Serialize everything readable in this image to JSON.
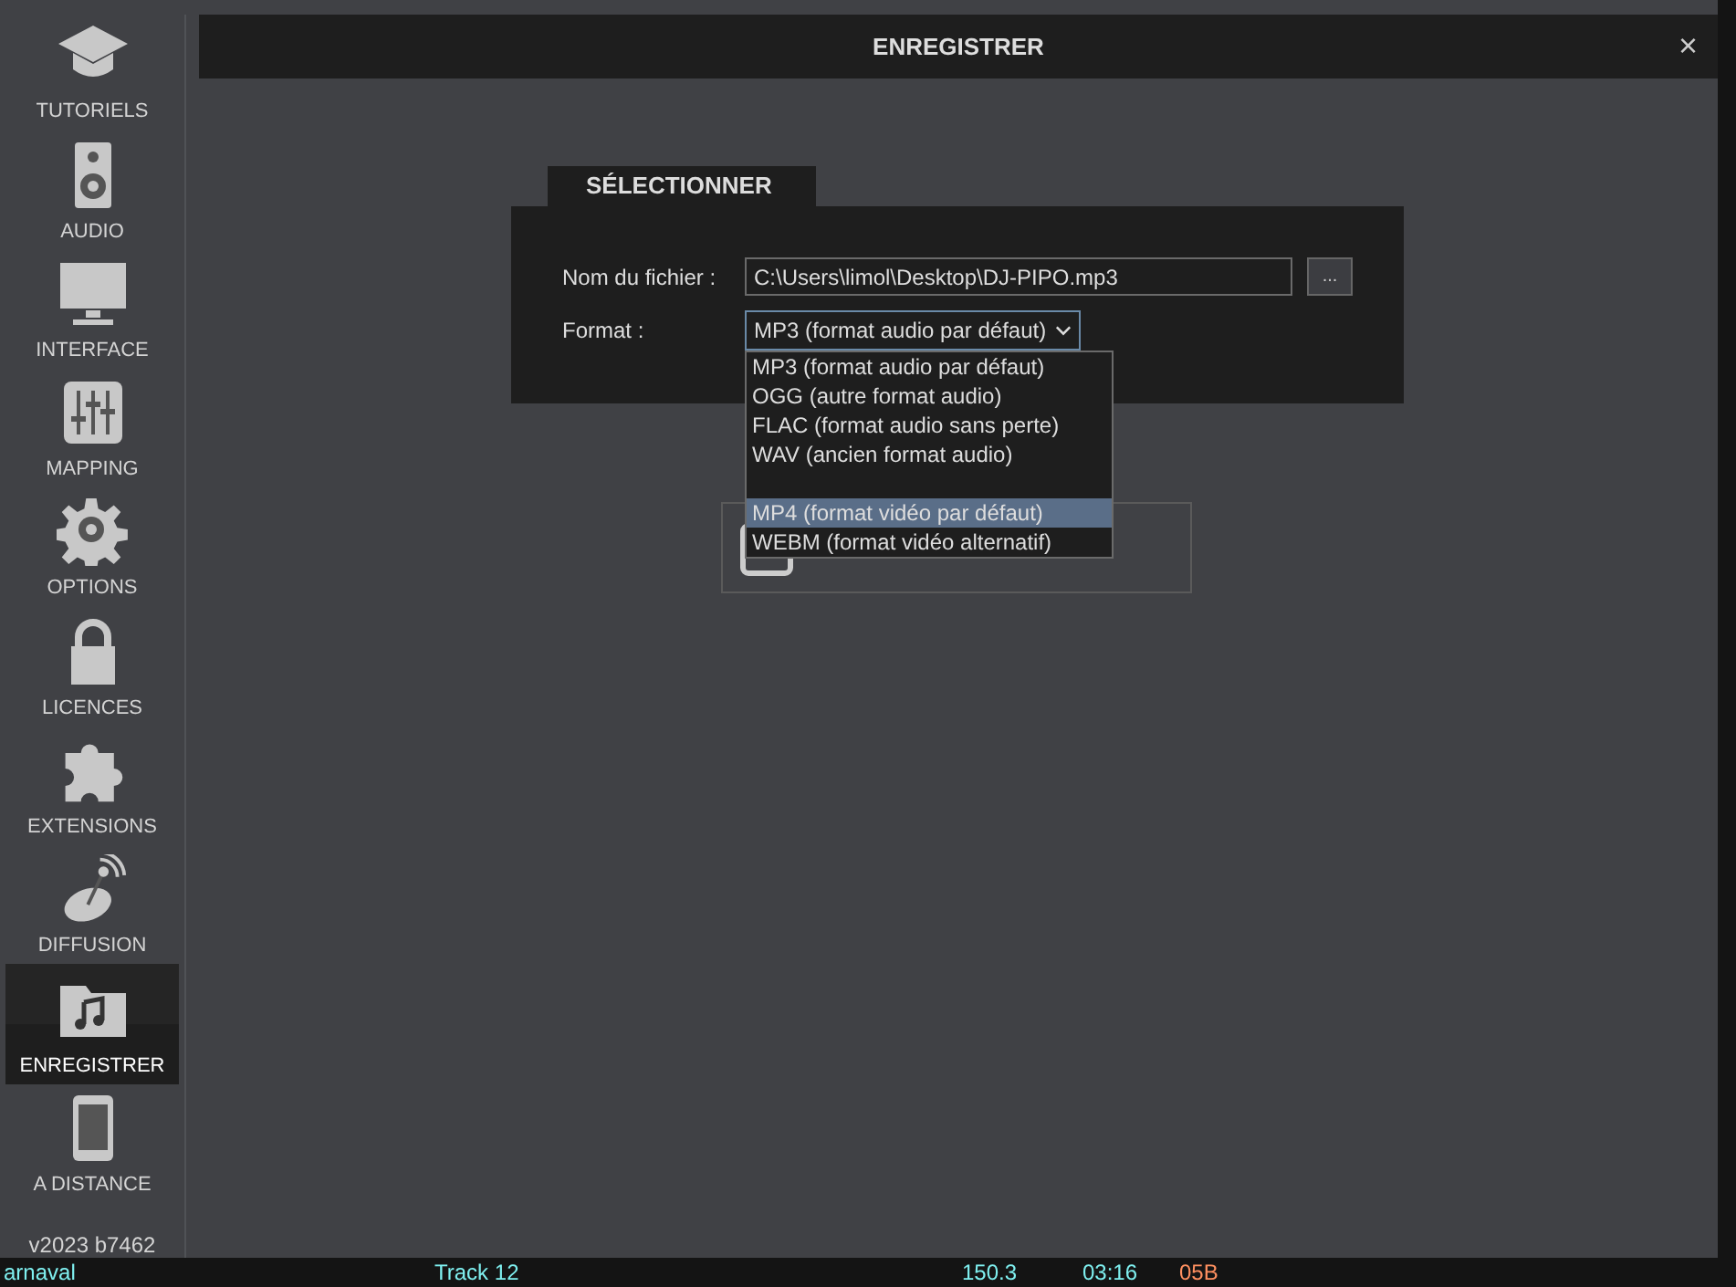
{
  "sidebar": {
    "items": [
      {
        "label": "TUTORIELS",
        "selected": false
      },
      {
        "label": "AUDIO",
        "selected": false
      },
      {
        "label": "INTERFACE",
        "selected": false
      },
      {
        "label": "MAPPING",
        "selected": false
      },
      {
        "label": "OPTIONS",
        "selected": false
      },
      {
        "label": "LICENCES",
        "selected": false
      },
      {
        "label": "EXTENSIONS",
        "selected": false
      },
      {
        "label": "DIFFUSION",
        "selected": false
      },
      {
        "label": "ENREGISTRER",
        "selected": true
      },
      {
        "label": "A DISTANCE",
        "selected": false
      }
    ],
    "version": "v2023 b7462"
  },
  "dialog": {
    "title": "ENREGISTRER",
    "close": "×",
    "panel": {
      "tab": "SÉLECTIONNER",
      "file_label": "Nom du fichier :",
      "file_value": "C:\\Users\\limol\\Desktop\\DJ-PIPO.mp3",
      "browse": "...",
      "format_label": "Format :",
      "format_value": "MP3 (format audio par défaut)",
      "format_options": [
        {
          "kind": "option",
          "label": "MP3 (format audio par défaut)",
          "selected": false
        },
        {
          "kind": "option",
          "label": "OGG (autre format audio)",
          "selected": false
        },
        {
          "kind": "option",
          "label": "FLAC (format audio sans perte)",
          "selected": false
        },
        {
          "kind": "option",
          "label": "WAV (ancien format audio)",
          "selected": false
        },
        {
          "kind": "gap"
        },
        {
          "kind": "option",
          "label": "MP4 (format vidéo par défaut)",
          "selected": true
        },
        {
          "kind": "option",
          "label": "WEBM (format vidéo alternatif)",
          "selected": false
        }
      ]
    }
  },
  "background_row": {
    "column_1": "arnaval",
    "column_2": "Track 12",
    "column_3": "150.3",
    "column_4": "03:16",
    "column_5": "05B"
  }
}
